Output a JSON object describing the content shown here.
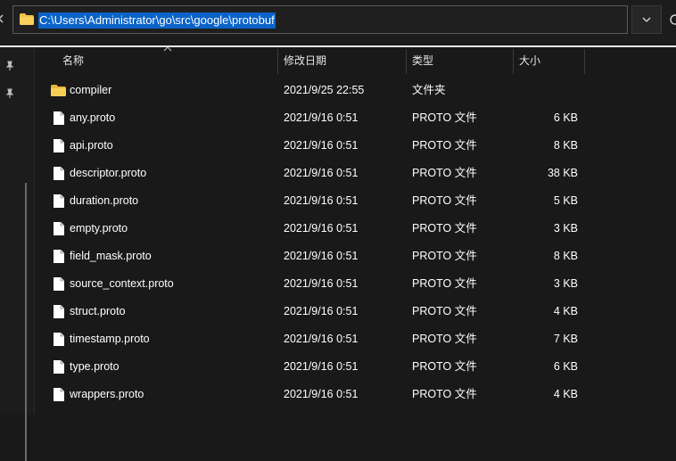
{
  "address_bar": {
    "path": "C:\\Users\\Administrator\\go\\src\\google\\protobuf"
  },
  "columns": {
    "name": "名称",
    "modified": "修改日期",
    "type": "类型",
    "size": "大小"
  },
  "rows": [
    {
      "name": "compiler",
      "modified": "2021/9/25 22:55",
      "type": "文件夹",
      "size": "",
      "icon": "folder-icon"
    },
    {
      "name": "any.proto",
      "modified": "2021/9/16 0:51",
      "type": "PROTO 文件",
      "size": "6 KB",
      "icon": "file-icon"
    },
    {
      "name": "api.proto",
      "modified": "2021/9/16 0:51",
      "type": "PROTO 文件",
      "size": "8 KB",
      "icon": "file-icon"
    },
    {
      "name": "descriptor.proto",
      "modified": "2021/9/16 0:51",
      "type": "PROTO 文件",
      "size": "38 KB",
      "icon": "file-icon"
    },
    {
      "name": "duration.proto",
      "modified": "2021/9/16 0:51",
      "type": "PROTO 文件",
      "size": "5 KB",
      "icon": "file-icon"
    },
    {
      "name": "empty.proto",
      "modified": "2021/9/16 0:51",
      "type": "PROTO 文件",
      "size": "3 KB",
      "icon": "file-icon"
    },
    {
      "name": "field_mask.proto",
      "modified": "2021/9/16 0:51",
      "type": "PROTO 文件",
      "size": "8 KB",
      "icon": "file-icon"
    },
    {
      "name": "source_context.proto",
      "modified": "2021/9/16 0:51",
      "type": "PROTO 文件",
      "size": "3 KB",
      "icon": "file-icon"
    },
    {
      "name": "struct.proto",
      "modified": "2021/9/16 0:51",
      "type": "PROTO 文件",
      "size": "4 KB",
      "icon": "file-icon"
    },
    {
      "name": "timestamp.proto",
      "modified": "2021/9/16 0:51",
      "type": "PROTO 文件",
      "size": "7 KB",
      "icon": "file-icon"
    },
    {
      "name": "type.proto",
      "modified": "2021/9/16 0:51",
      "type": "PROTO 文件",
      "size": "6 KB",
      "icon": "file-icon"
    },
    {
      "name": "wrappers.proto",
      "modified": "2021/9/16 0:51",
      "type": "PROTO 文件",
      "size": "4 KB",
      "icon": "file-icon"
    }
  ],
  "colors": {
    "selection": "#0a63c8",
    "folder": "#f3c24a",
    "background": "#191919"
  }
}
